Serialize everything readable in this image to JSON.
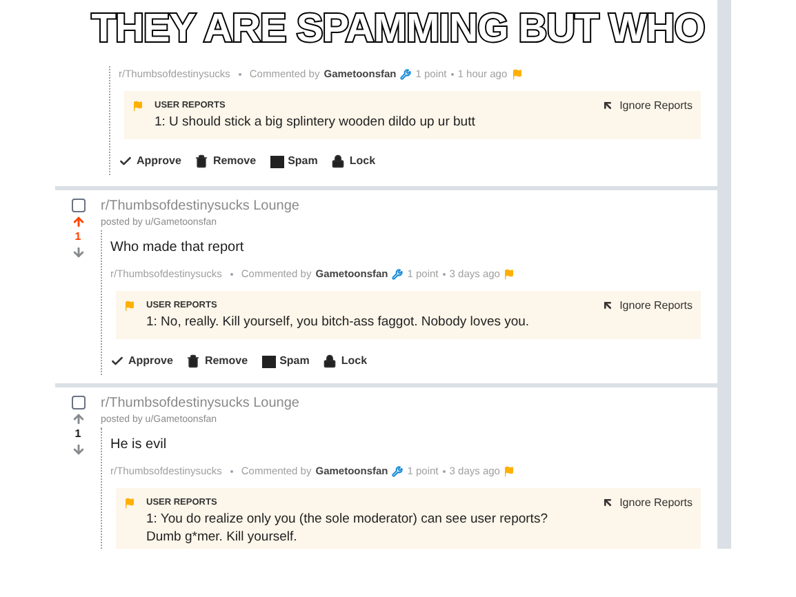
{
  "caption": "THEY ARE SPAMMING BUT WHO",
  "items": [
    {
      "subreddit": "r/Thumbsofdestinysucks",
      "commented_by": "Commented by",
      "author": "Gametoonsfan",
      "points": "1 point",
      "time": "1 hour ago",
      "report_heading": "USER REPORTS",
      "report": "1: U should stick a big splintery wooden dildo up ur butt",
      "ignore": "Ignore Reports",
      "actions": [
        {
          "kind": "approve",
          "label": "Approve"
        },
        {
          "kind": "remove",
          "label": "Remove"
        },
        {
          "kind": "spam",
          "label": "Spam"
        },
        {
          "kind": "lock",
          "label": "Lock"
        }
      ]
    },
    {
      "title": "r/Thumbsofdestinysucks Lounge",
      "posted_by": "posted by u/Gametoonsfan",
      "checked": false,
      "upvoted": true,
      "score": "1",
      "body": "Who made that report",
      "subreddit": "r/Thumbsofdestinysucks",
      "commented_by": "Commented by",
      "author": "Gametoonsfan",
      "points": "1 point",
      "time": "3 days ago",
      "report_heading": "USER REPORTS",
      "report": "1: No, really. Kill yourself, you bitch-ass faggot. Nobody loves you.",
      "ignore": "Ignore Reports",
      "actions": [
        {
          "kind": "approve",
          "label": "Approve"
        },
        {
          "kind": "remove",
          "label": "Remove"
        },
        {
          "kind": "spam",
          "label": "Spam"
        },
        {
          "kind": "lock",
          "label": "Lock"
        }
      ]
    },
    {
      "title": "r/Thumbsofdestinysucks Lounge",
      "posted_by": "posted by u/Gametoonsfan",
      "checked": false,
      "upvoted": false,
      "score": "1",
      "body": "He is evil",
      "subreddit": "r/Thumbsofdestinysucks",
      "commented_by": "Commented by",
      "author": "Gametoonsfan",
      "points": "1 point",
      "time": "3 days ago",
      "report_heading": "USER REPORTS",
      "report": "1: You do realize only you (the sole moderator) can see user reports?\nDumb g*mer. Kill yourself.",
      "ignore": "Ignore Reports"
    }
  ]
}
